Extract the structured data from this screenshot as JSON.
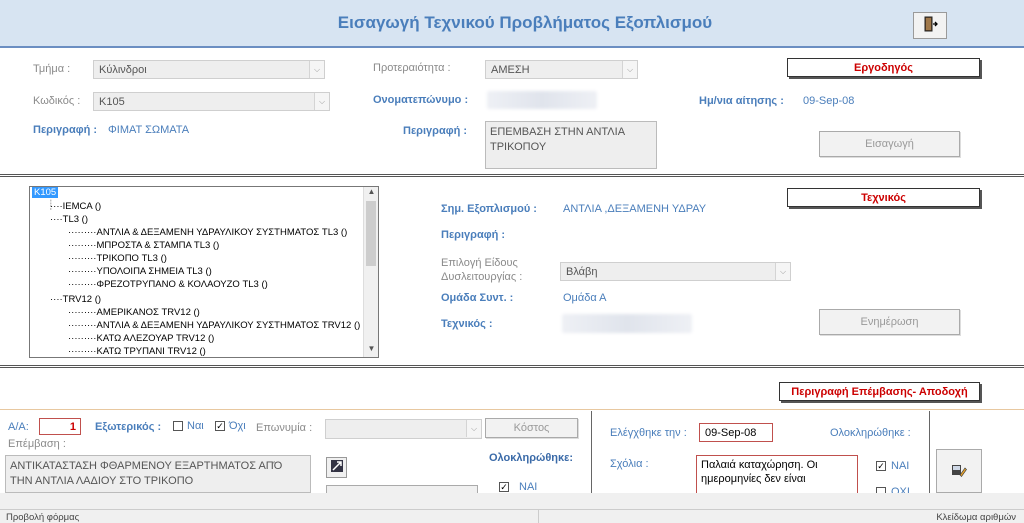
{
  "header": {
    "title": "Εισαγωγή Τεχνικού Προβλήματος Εξοπλισμού",
    "exit_icon": "exit-door-icon"
  },
  "request": {
    "department_label": "Τμήμα :",
    "department_value": "Κύλινδροι",
    "code_label": "Κωδικός :",
    "code_value": "K105",
    "description_label": "Περιγραφή :",
    "description_value": "ΦΙΜΑΤ ΣΩΜΑΤΑ",
    "priority_label": "Προτεραιότητα :",
    "priority_value": "ΑΜΕΣΗ",
    "fullname_label": "Ονοματεπώνυμο :",
    "problem_desc_label": "Περιγραφή :",
    "problem_desc_value": "ΕΠΕΜΒΑΣΗ ΣΤΗΝ ΑΝΤΛΙΑ ΤΡΙΚΟΠΟΥ",
    "request_date_label": "Ημ/νια αίτησης :",
    "request_date_value": "09-Sep-08",
    "tag": "Εργοδηγός",
    "submit_button": "Εισαγωγή"
  },
  "tree": {
    "root": "K105",
    "items": [
      "IEMCA ()",
      "TL3 ()",
      "ΑΝΤΛΙΑ & ΔΕΞΑΜΕΝΗ ΥΔΡΑΥΛΙΚΟΥ ΣΥΣΤΗΜΑΤΟΣ TL3 ()",
      "ΜΠΡΟΣΤΑ & ΣΤΑΜΠΑ TL3 ()",
      "ΤΡΙΚΟΠΟ TL3 ()",
      "ΥΠΟΛΟΙΠΑ ΣΗΜΕΙΑ TL3 ()",
      "ΦΡΕΖΟΤΡΥΠΑΝΟ & ΚΟΛΑΟΥΖΟ TL3 ()",
      "TRV12 ()",
      "ΑΜΕΡΙΚΑΝΟΣ TRV12 ()",
      "ΑΝΤΛΙΑ & ΔΕΞΑΜΕΝΗ ΥΔΡΑΥΛΙΚΟΥ ΣΥΣΤΗΜΑΤΟΣ TRV12 ()",
      "ΚΑΤΩ ΑΛΕΖΟΥΑΡ TRV12 ()",
      "ΚΑΤΩ ΤΡΥΠΑΝΙ TRV12 ()"
    ]
  },
  "technical": {
    "equipment_point_label": "Σημ. Εξοπλισμού :",
    "equipment_point_value": "ΑΝΤΛΙΑ ,ΔΕΞΑΜΕΝΗ ΥΔΡΑΥ",
    "description_label": "Περιγραφή :",
    "malfunction_label_line1": "Επιλογή Είδους",
    "malfunction_label_line2": "Δυσλειτουργίας :",
    "malfunction_value": "Βλάβη",
    "team_label": "Ομάδα Συντ. :",
    "team_value": "Ομάδα Α",
    "technician_label": "Τεχνικός :",
    "tag": "Τεχνικός",
    "update_button": "Ενημέρωση"
  },
  "intervention": {
    "tag": "Περιγραφή Επέμβασης- Αποδοχή",
    "aa_label": "Α/Α:",
    "aa_value": "1",
    "external_label": "Εξωτερικός :",
    "yes_label": "Ναι",
    "no_label": "Όχι",
    "brand_label": "Επωνυμία :",
    "cost_button": "Κόστος",
    "intervention_label": "Επέμβαση :",
    "intervention_value": "ΑΝΤΙΚΑΤΑΣΤΑΣΗ ΦΘΑΡΜΕΝΟΥ ΕΞΑΡΤΗΜΑΤΟΣ ΑΠΌ ΤΗΝ ΑΝΤΛΙΑ ΛΑΔΙΟΥ ΣΤΟ ΤΡΙΚΟΠΟ",
    "completed_label": "Ολοκληρώθηκε:",
    "completed_yes": "ΝΑΙ",
    "checked_on_label": "Ελέγχθηκε την :",
    "checked_on_value": "09-Sep-08",
    "completed2_label": "Ολοκληρώθηκε :",
    "comments_label": "Σχόλια :",
    "comments_value": "Παλαιά καταχώρηση. Οι ημερομηνίες δεν είναι",
    "completed2_yes": "ΝΑΙ",
    "completed2_no": "ΟΧΙ"
  },
  "status_bar": {
    "left": "Προβολή φόρμας",
    "right": "Κλείδωμα αριθμών"
  }
}
